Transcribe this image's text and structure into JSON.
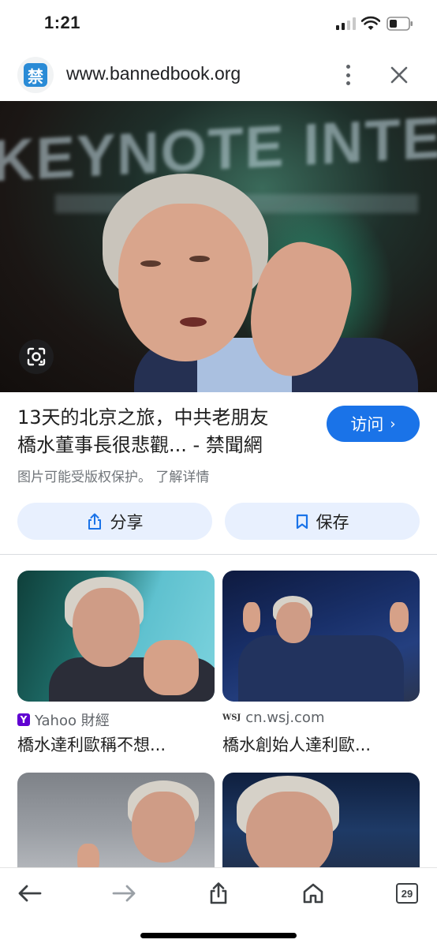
{
  "status_bar": {
    "time": "1:21"
  },
  "url_bar": {
    "favicon_char": "禁",
    "url": "www.bannedbook.org",
    "menu_icon": "more-vert-icon",
    "close_icon": "close-icon"
  },
  "hero": {
    "banner_text": "KEYNOTE INTERVIEW"
  },
  "result": {
    "title_line1": "13天的北京之旅，中共老朋友",
    "title_line2_main": "橋水董事長很悲觀...",
    "title_line2_sep": " - ",
    "title_source": "禁聞網",
    "visit_label": "访问",
    "visit_chevron": "›",
    "copyright_text": "图片可能受版权保护。",
    "learn_more": "了解详情"
  },
  "actions": {
    "share_label": "分享",
    "save_label": "保存"
  },
  "related": [
    {
      "source_icon": "Y",
      "source": "Yahoo 財經",
      "title": "橋水達利歐稱不想..."
    },
    {
      "source_icon": "WSJ",
      "source": "cn.wsj.com",
      "title": "橋水創始人達利歐..."
    }
  ],
  "toolbar": {
    "tab_count": "29"
  },
  "colors": {
    "accent": "#1a73e8",
    "button_bg": "#e8f0fe",
    "secondary_text": "#70757a"
  }
}
